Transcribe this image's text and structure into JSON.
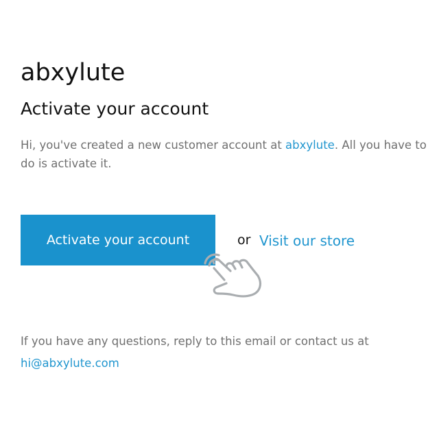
{
  "shop_name": "abxylute",
  "heading": "Activate your account",
  "intro": {
    "text_before": "Hi, you've created a new customer account at ",
    "shop_link": "abxylute",
    "text_after": ". All you have to do is activate it."
  },
  "cta": {
    "button_label": "Activate your account",
    "or_text": "or",
    "store_link": "Visit our store"
  },
  "footer": {
    "text": "If you have any questions, reply to this email or contact us at",
    "email": "hi@abxylute.com"
  },
  "colors": {
    "accent": "#1a92cd",
    "link": "#2196cf",
    "body_text": "#6f6f6f",
    "heading_text": "#111111"
  },
  "icons": {
    "pointer": "hand-pointer-click-icon"
  }
}
